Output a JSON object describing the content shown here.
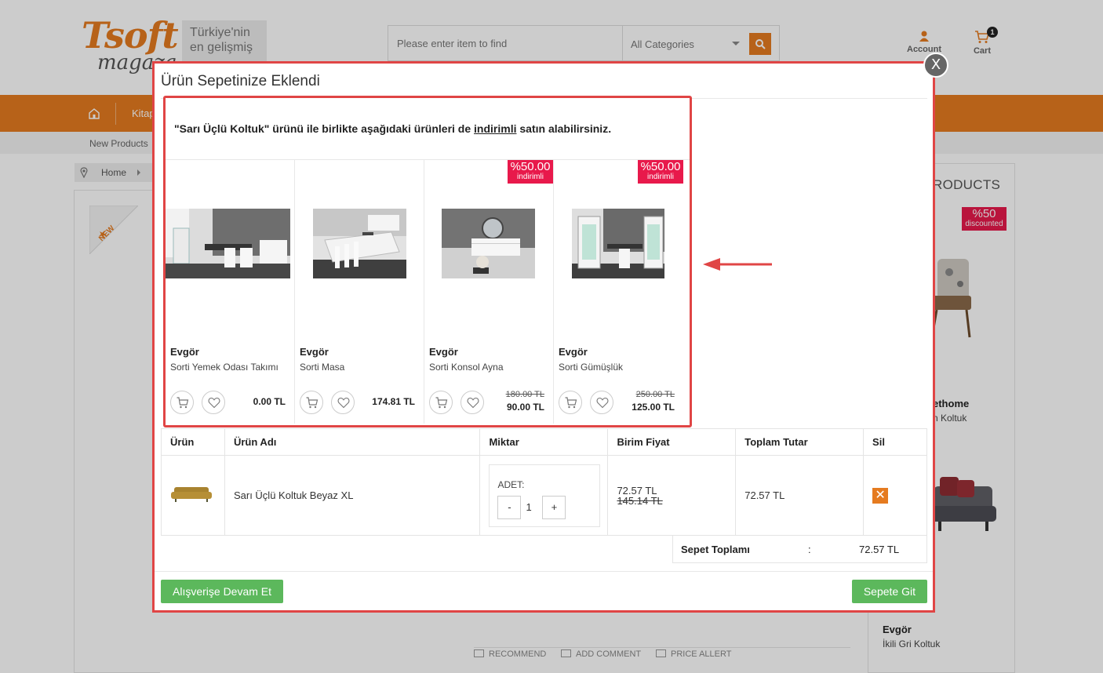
{
  "header": {
    "logo_main": "Tsoft",
    "logo_sub": "magaza",
    "slogan": "Türkiye'nin en gelişmiş",
    "search_placeholder": "Please enter item to find",
    "category_select": "All Categories",
    "account_label": "Account",
    "cart_label": "Cart",
    "cart_count": "1"
  },
  "nav": {
    "item_1": "Kitap",
    "subnav_item": "New Products"
  },
  "breadcrumb": {
    "home": "Home"
  },
  "side": {
    "new_badge": "NEW",
    "panel_title": "RODUCTS",
    "discount_pct": "%50",
    "discount_text": "discounted",
    "prod1_brand": "ethome",
    "prod1_name": "n Koltuk",
    "prod2_brand": "Evgör",
    "prod2_name": "İkili Gri Koltuk"
  },
  "bottom_actions": {
    "recommend": "RECOMMEND",
    "add_comment": "ADD COMMENT",
    "price_alert": "PRICE ALLERT"
  },
  "modal": {
    "title": "Ürün Sepetinize Eklendi",
    "close": "X",
    "msg_part1": "\"Sarı Üçlü Koltuk\" ürünü ile birlikte aşağıdaki ürünleri de",
    "msg_link": "indirimli",
    "msg_part2": "satın alabilirsiniz.",
    "products": [
      {
        "brand": "Evgör",
        "name": "Sorti Yemek Odası Takımı",
        "price": "0.00 TL",
        "old_price": "",
        "badge_pct": "",
        "badge_text": ""
      },
      {
        "brand": "Evgör",
        "name": "Sorti Masa",
        "price": "174.81 TL",
        "old_price": "",
        "badge_pct": "",
        "badge_text": ""
      },
      {
        "brand": "Evgör",
        "name": "Sorti Konsol Ayna",
        "price": "90.00 TL",
        "old_price": "180.00 TL",
        "badge_pct": "%50.00",
        "badge_text": "indirimli"
      },
      {
        "brand": "Evgör",
        "name": "Sorti Gümüşlük",
        "price": "125.00 TL",
        "old_price": "250.00 TL",
        "badge_pct": "%50.00",
        "badge_text": "indirimli"
      }
    ],
    "table": {
      "headers": [
        "Ürün",
        "Ürün Adı",
        "Miktar",
        "Birim Fiyat",
        "Toplam Tutar",
        "Sil"
      ],
      "row": {
        "name": "Sarı Üçlü Koltuk Beyaz XL",
        "qty_label": "ADET:",
        "qty_minus": "-",
        "qty_value": "1",
        "qty_plus": "+",
        "unit_price": "72.57 TL",
        "unit_old_price": "145.14 TL",
        "total": "72.57 TL",
        "delete": "✕"
      }
    },
    "cart_total_label": "Sepet Toplamı",
    "cart_total_colon": ":",
    "cart_total_value": "72.57 TL",
    "continue_button": "Alışverişe Devam Et",
    "checkout_button": "Sepete Git"
  },
  "colors": {
    "brand_orange": "#e57b20",
    "badge_red": "#e8194b",
    "button_green": "#5cb85c",
    "highlight_red": "#e04545"
  }
}
